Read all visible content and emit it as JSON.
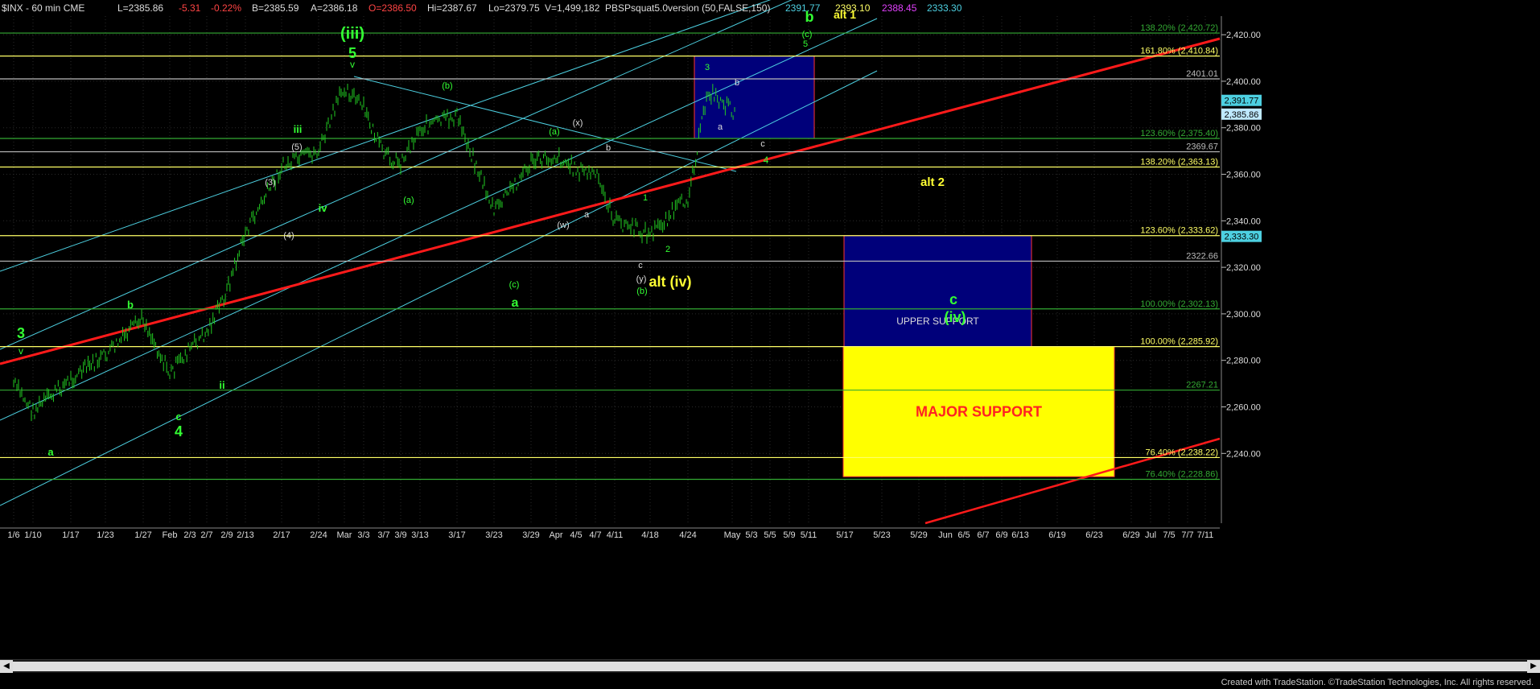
{
  "header": {
    "symbol": "$INX - 60 min  CME",
    "last": "L=2385.86",
    "change": "-5.31",
    "pct": "-0.22%",
    "bid": "B=2385.59",
    "ask": "A=2386.18",
    "open": "O=2386.50",
    "high": "Hi=2387.67",
    "low": "Lo=2379.75",
    "volume": "V=1,499,182",
    "indicator": "PBSPsquat5.0version (50,FALSE,150)",
    "ind_vals": [
      "2391.77",
      "2393.10",
      "2388.45",
      "2333.30"
    ],
    "ind_colors": [
      "#4dd0e1",
      "#ffff66",
      "#e040fb",
      "#4dd0e1"
    ]
  },
  "footer": "Created with TradeStation. ©TradeStation Technologies, Inc. All rights reserved.",
  "colors": {
    "background": "#000000",
    "bars": "#22cc22",
    "fib_line": "#ffff66",
    "channel": "#4dd0e1",
    "trendline": "#ff1a1a",
    "box_blue": "#00007a",
    "box_yellow": "#ffff00",
    "label_green": "#33ff33",
    "label_yellow": "#ffff33",
    "label_white": "#dddddd",
    "label_red": "#ff2222"
  },
  "chart_data": {
    "type": "line",
    "title": "$INX - 60 min",
    "ylim": [
      2210,
      2428
    ],
    "y_ticks": [
      "2,420.00",
      "2,400.00",
      "2,380.00",
      "2,360.00",
      "2,340.00",
      "2,320.00",
      "2,300.00",
      "2,280.00",
      "2,260.00",
      "2,240.00"
    ],
    "x_ticks": [
      "1/6",
      "1/10",
      "1/17",
      "1/23",
      "1/27",
      "Feb",
      "2/3",
      "2/7",
      "2/9",
      "2/13",
      "2/17",
      "2/24",
      "Mar",
      "3/3",
      "3/7",
      "3/9",
      "3/13",
      "3/17",
      "3/23",
      "3/29",
      "Apr",
      "4/5",
      "4/7",
      "4/11",
      "4/18",
      "4/24",
      "May",
      "5/3",
      "5/5",
      "5/9",
      "5/11",
      "5/17",
      "5/23",
      "5/29",
      "Jun",
      "6/5",
      "6/7",
      "6/9",
      "6/13",
      "6/19",
      "6/23",
      "6/29",
      "Jul",
      "7/5",
      "7/7",
      "7/11"
    ],
    "series": [
      {
        "name": "$INX",
        "x": [
          "1/6",
          "1/10",
          "1/17",
          "1/23",
          "1/27",
          "Feb",
          "2/3",
          "2/7",
          "2/9",
          "2/13",
          "2/17",
          "2/24",
          "Mar",
          "3/3",
          "3/7",
          "3/9",
          "3/13",
          "3/17",
          "3/23",
          "3/29",
          "Apr",
          "4/5",
          "4/7",
          "4/11",
          "4/18",
          "4/24",
          "4/26",
          "4/28"
        ],
        "y": [
          2270,
          2258,
          2272,
          2282,
          2298,
          2274,
          2285,
          2292,
          2310,
          2335,
          2363,
          2370,
          2398,
          2388,
          2368,
          2365,
          2380,
          2385,
          2344,
          2365,
          2368,
          2362,
          2360,
          2340,
          2334,
          2350,
          2396,
          2386
        ]
      }
    ],
    "fib_levels": [
      {
        "label": "138.20% (2,420.72)",
        "value": 2420.72,
        "color": "#33aa33"
      },
      {
        "label": "161.80% (2,410.84)",
        "value": 2410.84,
        "color": "#ffff66"
      },
      {
        "label": "2401.01",
        "value": 2401.01,
        "color": "#bbbbbb"
      },
      {
        "label": "123.60% (2,375.40)",
        "value": 2375.4,
        "color": "#33aa33"
      },
      {
        "label": "2369.67",
        "value": 2369.67,
        "color": "#bbbbbb"
      },
      {
        "label": "138.20% (2,363.13)",
        "value": 2363.13,
        "color": "#ffff66"
      },
      {
        "label": "123.60% (2,333.62)",
        "value": 2333.62,
        "color": "#ffff66"
      },
      {
        "label": "2322.66",
        "value": 2322.66,
        "color": "#bbbbbb"
      },
      {
        "label": "100.00% (2,302.13)",
        "value": 2302.13,
        "color": "#33aa33"
      },
      {
        "label": "100.00% (2,285.92)",
        "value": 2285.92,
        "color": "#ffff66"
      },
      {
        "label": "2267.21",
        "value": 2267.21,
        "color": "#33aa33"
      },
      {
        "label": "76.40% (2,238.22)",
        "value": 2238.22,
        "color": "#ffff66"
      },
      {
        "label": "76.40% (2,228.86)",
        "value": 2228.86,
        "color": "#33aa33"
      }
    ],
    "price_tags": [
      {
        "text": "2,391.77",
        "value": 2391.77,
        "bg": "#4dd0e1"
      },
      {
        "text": "2,385.86",
        "value": 2385.86,
        "bg": "#bfe9ff"
      },
      {
        "text": "2,333.30",
        "value": 2333.3,
        "bg": "#4dd0e1"
      }
    ],
    "boxes": [
      {
        "name": "target-box",
        "x_from": "4/24",
        "x_to": "5/11",
        "y_from": 2410.84,
        "y_to": 2375.4,
        "color": "#00007a"
      },
      {
        "name": "upper-support-box",
        "label": "UPPER SUPPORT",
        "x_from": "5/17",
        "x_to": "6/13",
        "y_from": 2333.62,
        "y_to": 2285.92,
        "color": "#00007a"
      },
      {
        "name": "major-support-box",
        "label": "MAJOR SUPPORT",
        "x_from": "5/17",
        "x_to": "6/23",
        "y_from": 2285.92,
        "y_to": 2230.0,
        "color": "#ffff00"
      }
    ],
    "wave_labels": [
      {
        "text": "3",
        "color": "#33ff33",
        "size": 18
      },
      {
        "text": "v",
        "color": "#33ff33",
        "size": 12
      },
      {
        "text": "a",
        "color": "#33ff33",
        "size": 13
      },
      {
        "text": "b",
        "color": "#33ff33",
        "size": 13
      },
      {
        "text": "c",
        "color": "#33ff33",
        "size": 13
      },
      {
        "text": "4",
        "color": "#33ff33",
        "size": 18
      },
      {
        "text": "ii",
        "color": "#33ff33",
        "size": 13
      },
      {
        "text": "iii",
        "color": "#33ff33",
        "size": 13
      },
      {
        "text": "iv",
        "color": "#33ff33",
        "size": 13
      },
      {
        "text": "(3)",
        "color": "#dddddd",
        "size": 11
      },
      {
        "text": "(4)",
        "color": "#dddddd",
        "size": 11
      },
      {
        "text": "(5)",
        "color": "#dddddd",
        "size": 11
      },
      {
        "text": "(iii)",
        "color": "#33ff33",
        "size": 20
      },
      {
        "text": "5",
        "color": "#33ff33",
        "size": 18
      },
      {
        "text": "v",
        "color": "#33ff33",
        "size": 12
      },
      {
        "text": "(b)",
        "color": "#33ff33",
        "size": 11
      },
      {
        "text": "(a)",
        "color": "#33ff33",
        "size": 11
      },
      {
        "text": "(a)",
        "color": "#33ff33",
        "size": 11
      },
      {
        "text": "(c)",
        "color": "#33ff33",
        "size": 11
      },
      {
        "text": "a",
        "color": "#33ff33",
        "size": 16
      },
      {
        "text": "(x)",
        "color": "#dddddd",
        "size": 11
      },
      {
        "text": "(w)",
        "color": "#dddddd",
        "size": 11
      },
      {
        "text": "a",
        "color": "#dddddd",
        "size": 11
      },
      {
        "text": "b",
        "color": "#dddddd",
        "size": 11
      },
      {
        "text": "c",
        "color": "#dddddd",
        "size": 11
      },
      {
        "text": "(y)",
        "color": "#dddddd",
        "size": 11
      },
      {
        "text": "(b)",
        "color": "#33ff33",
        "size": 11
      },
      {
        "text": "1",
        "color": "#33ff33",
        "size": 11
      },
      {
        "text": "2",
        "color": "#33ff33",
        "size": 11
      },
      {
        "text": "alt (iv)",
        "color": "#ffff33",
        "size": 18
      },
      {
        "text": "3",
        "color": "#33ff33",
        "size": 11
      },
      {
        "text": "a",
        "color": "#dddddd",
        "size": 11
      },
      {
        "text": "b",
        "color": "#dddddd",
        "size": 11
      },
      {
        "text": "c",
        "color": "#dddddd",
        "size": 11
      },
      {
        "text": "4",
        "color": "#33ff33",
        "size": 12
      },
      {
        "text": "b",
        "color": "#33ff33",
        "size": 18
      },
      {
        "text": "(c)",
        "color": "#33ff33",
        "size": 11
      },
      {
        "text": "5",
        "color": "#33ff33",
        "size": 11
      },
      {
        "text": "alt 1",
        "color": "#ffff33",
        "size": 14
      },
      {
        "text": "alt 2",
        "color": "#ffff33",
        "size": 15
      },
      {
        "text": "c",
        "color": "#33ff33",
        "size": 18
      },
      {
        "text": "(iv)",
        "color": "#33ff33",
        "size": 18
      }
    ]
  }
}
